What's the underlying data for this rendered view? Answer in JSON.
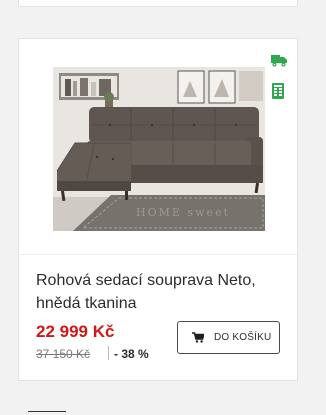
{
  "product": {
    "name": "Rohová sedací souprava Neto, hnědá tkanina",
    "price": "22 999 Kč",
    "old_price": "37 150 Kč",
    "discount": "- 38 %",
    "cart_label": "DO KOŠÍKU",
    "image_icon": "corner-sofa-photo",
    "rug_text": "HOME sweet"
  },
  "icons": {
    "delivery": "truck-icon",
    "stock": "stock-availability-icon",
    "cart": "cart-icon"
  },
  "colors": {
    "price": "#d01818",
    "status_green": "#2fa84f",
    "button_border": "#4a4a4a"
  }
}
